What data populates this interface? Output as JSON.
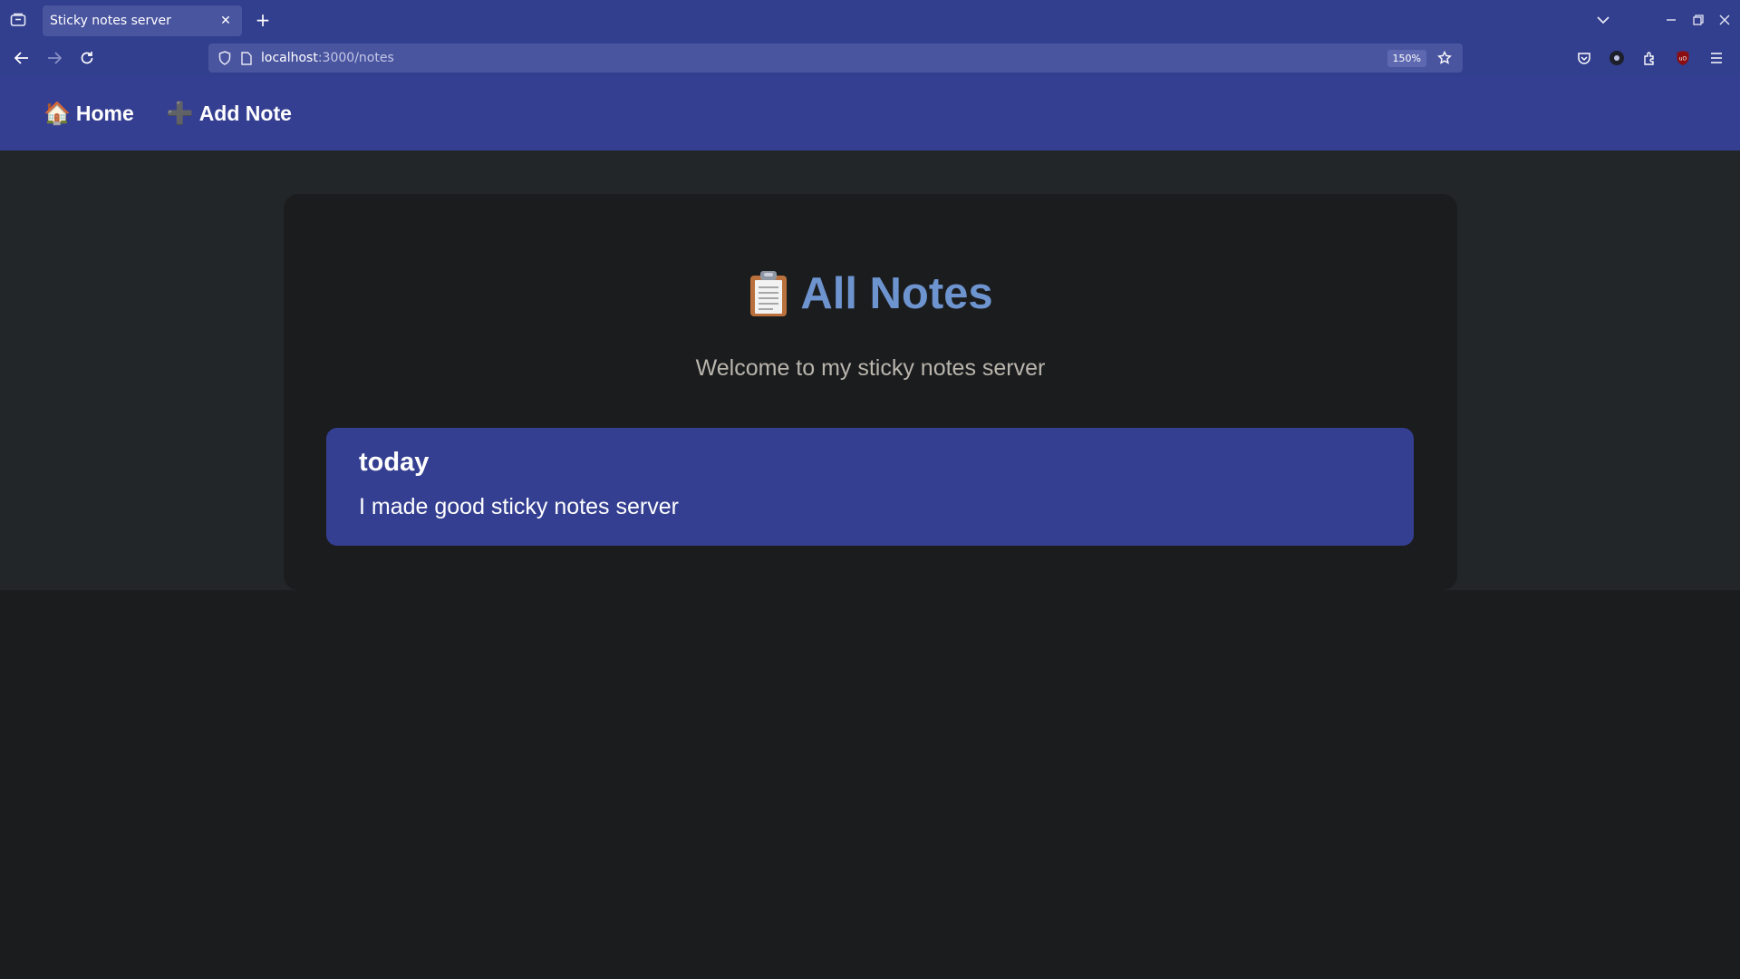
{
  "browser": {
    "tab_title": "Sticky notes server",
    "url_host": "localhost",
    "url_path": ":3000/notes",
    "zoom": "150%"
  },
  "nav": {
    "home_emoji": "🏠",
    "home_label": "Home",
    "add_emoji": "➕",
    "add_label": "Add Note"
  },
  "main": {
    "title": "All Notes",
    "subtitle": "Welcome to my sticky notes server",
    "notes": [
      {
        "title": "today",
        "body": "I made good sticky notes server"
      }
    ]
  },
  "colors": {
    "header": "#353f91",
    "title": "#6d94cf",
    "note_bg": "#353f91",
    "page_bg": "#232628"
  }
}
